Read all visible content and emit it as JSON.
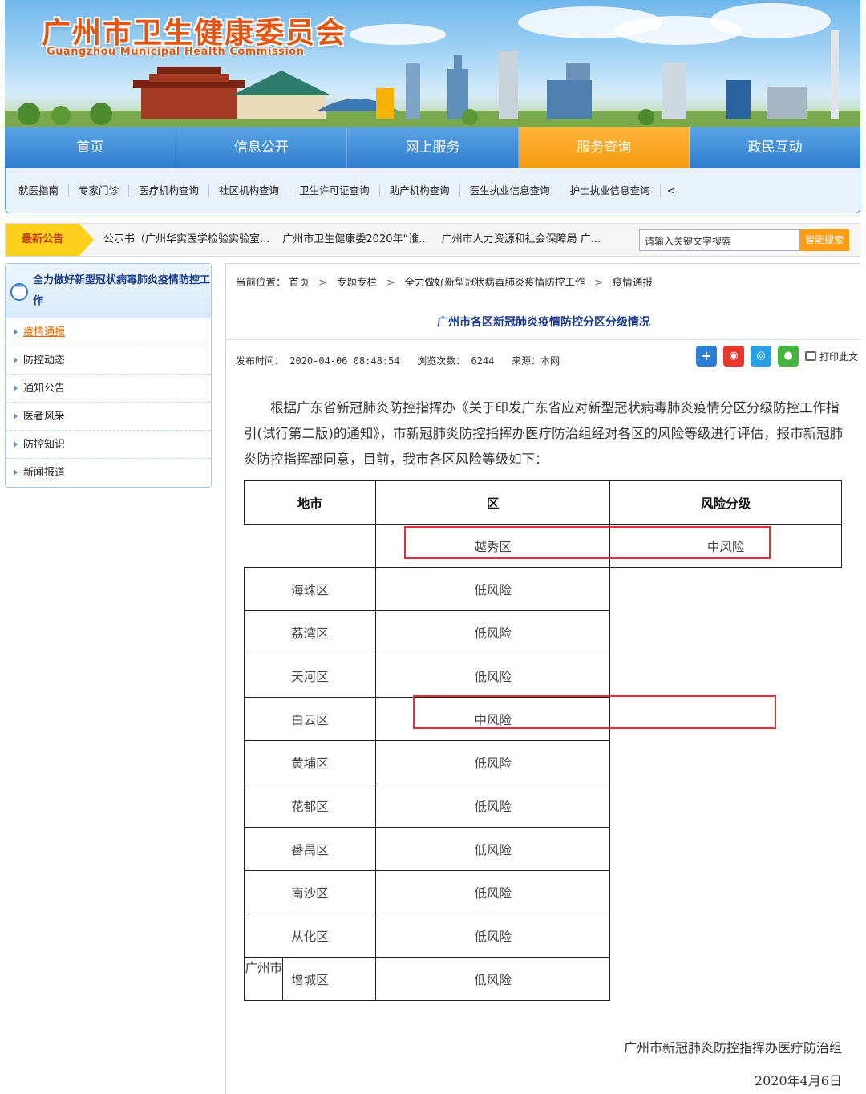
{
  "header": {
    "title": "广州市卫生健康委员会",
    "subtitle": "Guangzhou Municipal Health Commission"
  },
  "main_nav": [
    {
      "label": "首页"
    },
    {
      "label": "信息公开"
    },
    {
      "label": "网上服务"
    },
    {
      "label": "服务查询",
      "active": true
    },
    {
      "label": "政民互动"
    }
  ],
  "sub_nav": [
    "就医指南",
    "专家门诊",
    "医疗机构查询",
    "社区机构查询",
    "卫生许可证查询",
    "助产机构查询",
    "医生执业信息查询",
    "护士执业信息查询",
    "<"
  ],
  "notice": {
    "tag": "最新公告",
    "items": [
      "公示书（广州华实医学检验实验室...",
      "广州市卫生健康委2020年“谁...",
      "广州市人力资源和社会保障局 广..."
    ],
    "search_placeholder": "请输入关键文字搜索",
    "search_button": "智能搜索"
  },
  "sidebar": {
    "title": "全力做好新型冠状病毒肺炎疫情防控工作",
    "items": [
      "疫情通报",
      "防控动态",
      "通知公告",
      "医者风采",
      "防控知识",
      "新闻报道"
    ],
    "active_index": 0
  },
  "breadcrumb": {
    "prefix": "当前位置：",
    "items": [
      "首页",
      "专题专栏",
      "全力做好新型冠状病毒肺炎疫情防控工作",
      "疫情通报"
    ],
    "sep": ">"
  },
  "article": {
    "title": "广州市各区新冠肺炎疫情防控分区分级情况",
    "meta": {
      "publish_label": "发布时间：",
      "publish_time": "2020-04-06 08:48:54",
      "views_label": "浏览次数：",
      "views": "6244",
      "source_label": "来源：",
      "source": "本网"
    },
    "print_label": "打印此文",
    "paragraph": "根据广东省新冠肺炎防控指挥办《关于印发广东省应对新型冠状病毒肺炎疫情分区分级防控工作指引(试行第二版)的通知》，市新冠肺炎防控指挥办医疗防治组经对各区的风险等级进行评估，报市新冠肺炎防控指挥部同意，目前，我市各区风险等级如下：",
    "table": {
      "headers": [
        "地市",
        "区",
        "风险分级"
      ],
      "city": "广州市",
      "rows": [
        {
          "district": "越秀区",
          "risk": "中风险"
        },
        {
          "district": "海珠区",
          "risk": "低风险"
        },
        {
          "district": "荔湾区",
          "risk": "低风险"
        },
        {
          "district": "天河区",
          "risk": "低风险"
        },
        {
          "district": "白云区",
          "risk": "中风险"
        },
        {
          "district": "黄埔区",
          "risk": "低风险"
        },
        {
          "district": "花都区",
          "risk": "低风险"
        },
        {
          "district": "番禺区",
          "risk": "低风险"
        },
        {
          "district": "南沙区",
          "risk": "低风险"
        },
        {
          "district": "从化区",
          "risk": "低风险"
        },
        {
          "district": "增城区",
          "risk": "低风险"
        }
      ]
    },
    "signature": "广州市新冠肺炎防控指挥办医疗防治组",
    "date": "2020年4月6日"
  },
  "colors": {
    "nav_blue": "#2f7ccd",
    "nav_active": "#f59b12",
    "title_blue": "#1a3b8a",
    "highlight_red": "#e0303a",
    "brand_orange": "#e8530e"
  }
}
